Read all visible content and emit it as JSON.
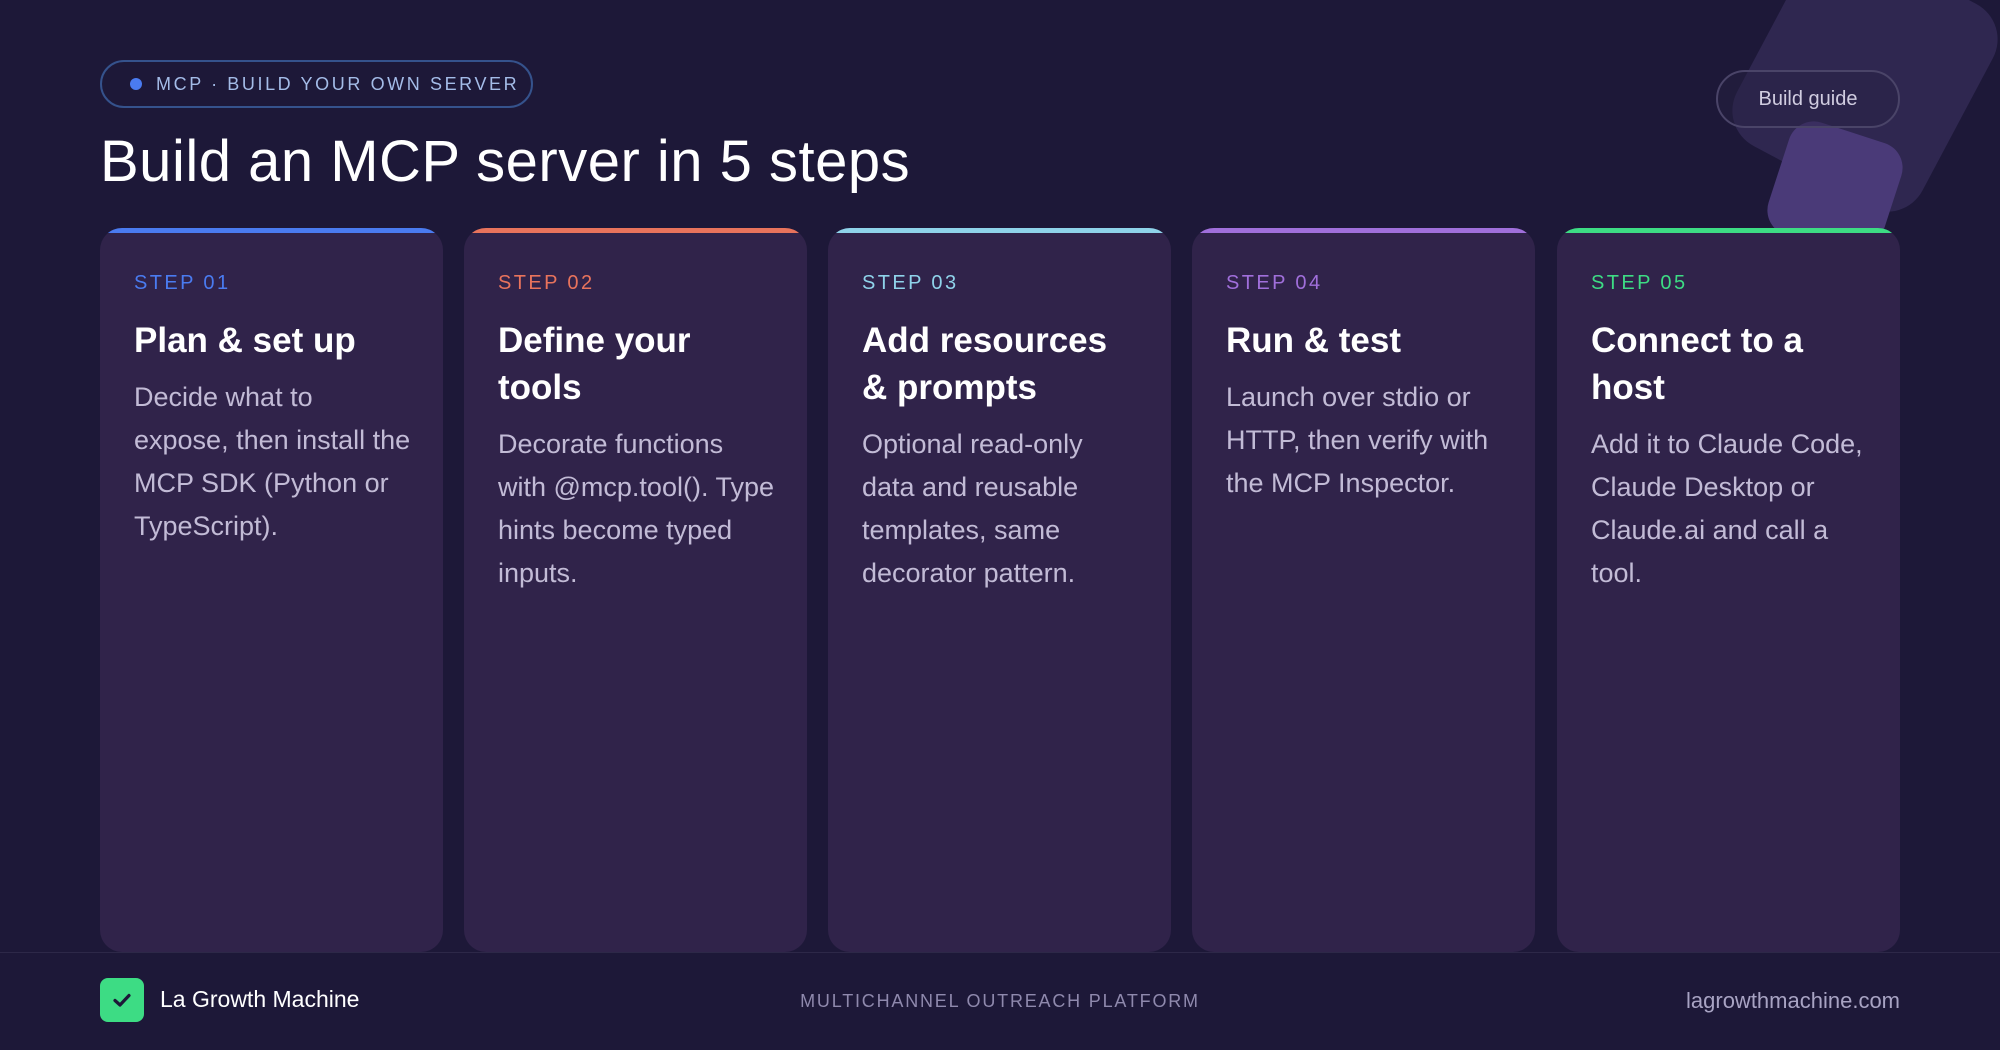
{
  "badge": {
    "text": "MCP · BUILD YOUR OWN SERVER"
  },
  "guide_button": {
    "label": "Build guide"
  },
  "title": "Build an MCP server in 5 steps",
  "steps": [
    {
      "label": "STEP 01",
      "title": "Plan & set up",
      "description": "Decide what to expose, then install the MCP SDK (Python or TypeScript).",
      "accent": "#4a7bf0"
    },
    {
      "label": "STEP 02",
      "title": "Define your tools",
      "description": "Decorate functions with @mcp.tool(). Type hints become typed inputs.",
      "accent": "#e8735c"
    },
    {
      "label": "STEP 03",
      "title": "Add resources & prompts",
      "description": "Optional read-only data and reusable templates, same decorator pattern.",
      "accent": "#8fd3ea"
    },
    {
      "label": "STEP 04",
      "title": "Run & test",
      "description": "Launch over stdio or HTTP, then verify with the MCP Inspector.",
      "accent": "#a06fdb"
    },
    {
      "label": "STEP 05",
      "title": "Connect to a host",
      "description": "Add it to Claude Code, Claude Desktop or Claude.ai and call a tool.",
      "accent": "#3ddc84"
    }
  ],
  "footer": {
    "brand": "La Growth Machine",
    "tagline": "MULTICHANNEL OUTREACH PLATFORM",
    "site": "lagrowthmachine.com"
  },
  "icons": {
    "logo": "check-icon",
    "badge_dot": "dot-icon"
  }
}
